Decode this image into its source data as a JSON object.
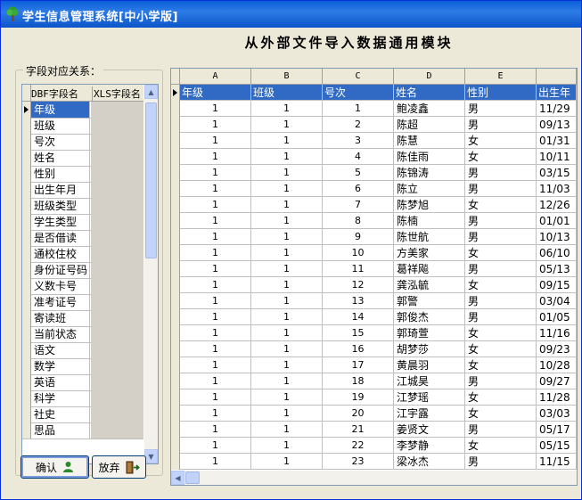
{
  "window": {
    "title": "学生信息管理系统[中小学版]"
  },
  "heading": "从外部文件导入数据通用模块",
  "mapping": {
    "group_label": "字段对应关系：",
    "headers": [
      "DBF字段名",
      "XLS字段名"
    ],
    "fields": [
      "年级",
      "班级",
      "号次",
      "姓名",
      "性别",
      "出生年月",
      "班级类型",
      "学生类型",
      "是否借读",
      "通校住校",
      "身份证号码",
      "义数卡号",
      "准考证号",
      "寄读班",
      "当前状态",
      "语文",
      "数学",
      "英语",
      "科学",
      "社史",
      "思品"
    ],
    "selected_index": 0
  },
  "buttons": {
    "confirm": "确认",
    "cancel": "放弃"
  },
  "sheet": {
    "column_letters": [
      "A",
      "B",
      "C",
      "D",
      "E",
      ""
    ],
    "headers": [
      "年级",
      "班级",
      "号次",
      "姓名",
      "性别",
      "出生年"
    ],
    "rows": [
      [
        "1",
        "1",
        "1",
        "鲍凌鑫",
        "男",
        "11/29"
      ],
      [
        "1",
        "1",
        "2",
        "陈超",
        "男",
        "09/13"
      ],
      [
        "1",
        "1",
        "3",
        "陈慧",
        "女",
        "01/31"
      ],
      [
        "1",
        "1",
        "4",
        "陈佳雨",
        "女",
        "10/11"
      ],
      [
        "1",
        "1",
        "5",
        "陈锦涛",
        "男",
        "03/15"
      ],
      [
        "1",
        "1",
        "6",
        "陈立",
        "男",
        "11/03"
      ],
      [
        "1",
        "1",
        "7",
        "陈梦旭",
        "女",
        "12/26"
      ],
      [
        "1",
        "1",
        "8",
        "陈楠",
        "男",
        "01/01"
      ],
      [
        "1",
        "1",
        "9",
        "陈世航",
        "男",
        "10/13"
      ],
      [
        "1",
        "1",
        "10",
        "方美家",
        "女",
        "06/10"
      ],
      [
        "1",
        "1",
        "11",
        "葛祥飚",
        "男",
        "05/13"
      ],
      [
        "1",
        "1",
        "12",
        "龚泓毓",
        "女",
        "09/15"
      ],
      [
        "1",
        "1",
        "13",
        "郭警",
        "男",
        "03/04"
      ],
      [
        "1",
        "1",
        "14",
        "郭俊杰",
        "男",
        "01/05"
      ],
      [
        "1",
        "1",
        "15",
        "郭琦萱",
        "女",
        "11/16"
      ],
      [
        "1",
        "1",
        "16",
        "胡梦莎",
        "女",
        "09/23"
      ],
      [
        "1",
        "1",
        "17",
        "黄晨羽",
        "女",
        "10/28"
      ],
      [
        "1",
        "1",
        "18",
        "江城昊",
        "男",
        "09/27"
      ],
      [
        "1",
        "1",
        "19",
        "江梦瑶",
        "女",
        "11/28"
      ],
      [
        "1",
        "1",
        "20",
        "江宇露",
        "女",
        "03/03"
      ],
      [
        "1",
        "1",
        "21",
        "姜贤文",
        "男",
        "05/17"
      ],
      [
        "1",
        "1",
        "22",
        "李梦静",
        "女",
        "05/15"
      ],
      [
        "1",
        "1",
        "23",
        "梁冰杰",
        "男",
        "11/15"
      ]
    ]
  },
  "icons": {
    "app": "tree-icon",
    "confirm": "person-icon",
    "cancel": "exit-door-icon"
  }
}
